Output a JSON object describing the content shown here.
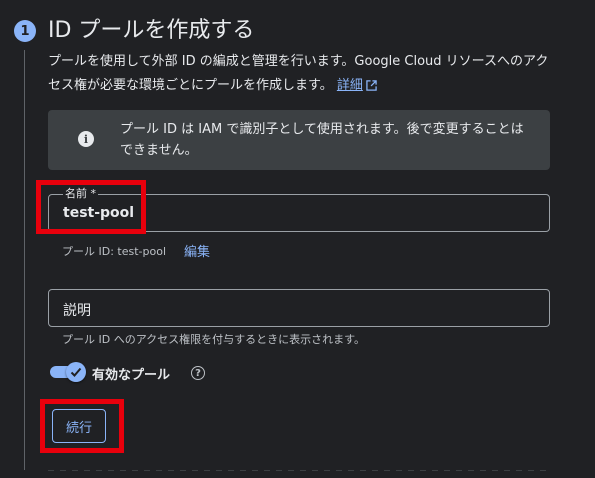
{
  "step": {
    "number": "1",
    "title": "ID プールを作成する"
  },
  "description": {
    "text": "プールを使用して外部 ID の編成と管理を行います。Google Cloud リソースへのアクセス権が必要な環境ごとにプールを作成します。",
    "link_label": "詳細"
  },
  "info": {
    "icon": "info-icon",
    "text": "プール ID は IAM で識別子として使用されます。後で変更することはできません。"
  },
  "name_field": {
    "label": "名前 *",
    "value": "test-pool"
  },
  "pool_id_hint": {
    "text": "プール ID: test-pool",
    "edit_label": "編集"
  },
  "description_field": {
    "placeholder": "説明",
    "hint": "プール ID へのアクセス権限を付与するときに表示されます。"
  },
  "enable_toggle": {
    "label": "有効なプール",
    "checked": true,
    "help_icon": "help-icon"
  },
  "actions": {
    "continue_label": "続行"
  },
  "colors": {
    "background": "#202124",
    "accent": "#8ab4f8",
    "highlight": "#e8000c",
    "info_background": "#3c4043"
  }
}
